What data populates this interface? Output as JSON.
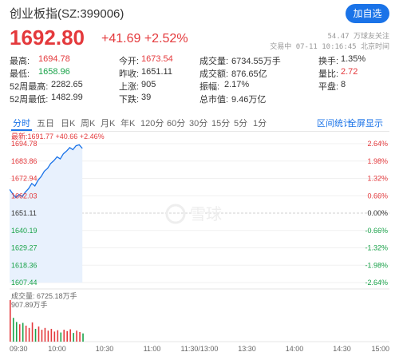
{
  "header": {
    "title": "创业板指(SZ:399006)",
    "follow_button": "加自选",
    "price": "1692.80",
    "change": "+41.69 +2.52%",
    "followers": "54.47 万球友关注",
    "status": "交易中 07-11 10:16:45 北京时间"
  },
  "stats": {
    "high_label": "最高:",
    "high": "1694.78",
    "low_label": "最低:",
    "low": "1658.96",
    "wk52_high_label": "52周最高:",
    "wk52_high": "2282.65",
    "wk52_low_label": "52周最低:",
    "wk52_low": "1482.99",
    "open_label": "今开:",
    "open": "1673.54",
    "prev_close_label": "昨收:",
    "prev_close": "1651.11",
    "up_label": "上涨:",
    "up": "905",
    "down_label": "下跌:",
    "down": "39",
    "volume_label": "成交量:",
    "volume": "6734.55万手",
    "amount_label": "成交额:",
    "amount": "876.65亿",
    "amplitude_label": "振幅:",
    "amplitude": "2.17%",
    "mktcap_label": "总市值:",
    "mktcap": "9.46万亿",
    "turnover_label": "换手:",
    "turnover": "1.35%",
    "vol_ratio_label": "量比:",
    "vol_ratio": "2.72",
    "flat_label": "平盘:",
    "flat": "8"
  },
  "tabs": [
    "分时",
    "五日",
    "日K",
    "周K",
    "月K",
    "年K",
    "120分",
    "60分",
    "30分",
    "15分",
    "5分",
    "1分"
  ],
  "active_tab": 0,
  "tab_links": {
    "stats": "区间统计",
    "show_all": "全屏显示"
  },
  "chart_legend": "最新:1691.77 +40.66 +2.46%",
  "volume_legend": "成交量: 6725.18万手",
  "volume_max_label": "907.89万手",
  "colors": {
    "up": "#e4393c",
    "down": "#1aa34a",
    "line": "#1a73e8",
    "accent": "#1a73e8"
  },
  "chart_data": {
    "type": "line",
    "price_axis": [
      "1694.78",
      "1683.86",
      "1672.94",
      "1662.03",
      "1651.11",
      "1640.19",
      "1629.27",
      "1618.36",
      "1607.44"
    ],
    "pct_axis": [
      "2.64%",
      "1.98%",
      "1.32%",
      "0.66%",
      "0.00%",
      "-0.66%",
      "-1.32%",
      "-1.98%",
      "-2.64%"
    ],
    "ylim": [
      1607.44,
      1694.78
    ],
    "time_axis": [
      "09:30",
      "10:00",
      "10:30",
      "11:00",
      "11:30/13:00",
      "13:30",
      "14:00",
      "14:30",
      "15:00"
    ],
    "x": [
      "09:30",
      "09:32",
      "09:34",
      "09:36",
      "09:38",
      "09:40",
      "09:42",
      "09:44",
      "09:46",
      "09:48",
      "09:50",
      "09:52",
      "09:54",
      "09:56",
      "09:58",
      "10:00",
      "10:02",
      "10:04",
      "10:06",
      "10:08",
      "10:10",
      "10:12",
      "10:14",
      "10:16"
    ],
    "values": [
      1666.0,
      1663.2,
      1660.9,
      1662.8,
      1661.5,
      1664.4,
      1666.5,
      1669.8,
      1668.2,
      1671.8,
      1674.2,
      1677.5,
      1679.2,
      1682.4,
      1684.1,
      1686.5,
      1685.2,
      1688.4,
      1690.1,
      1692.3,
      1691.0,
      1693.5,
      1694.1,
      1691.8
    ],
    "volumes": [
      907.89,
      520,
      430,
      380,
      410,
      350,
      300,
      420,
      280,
      330,
      260,
      300,
      240,
      280,
      220,
      250,
      200,
      260,
      230,
      270,
      190,
      240,
      210,
      180
    ]
  }
}
